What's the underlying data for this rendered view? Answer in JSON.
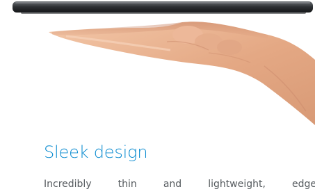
{
  "feature": {
    "title": "Sleek design",
    "description": "Incredibly thin and lightweight, edge",
    "title_color": "#0a8bd0",
    "text_color": "#555a5e"
  },
  "image": {
    "subject": "hand-holding-tablet-edge"
  }
}
